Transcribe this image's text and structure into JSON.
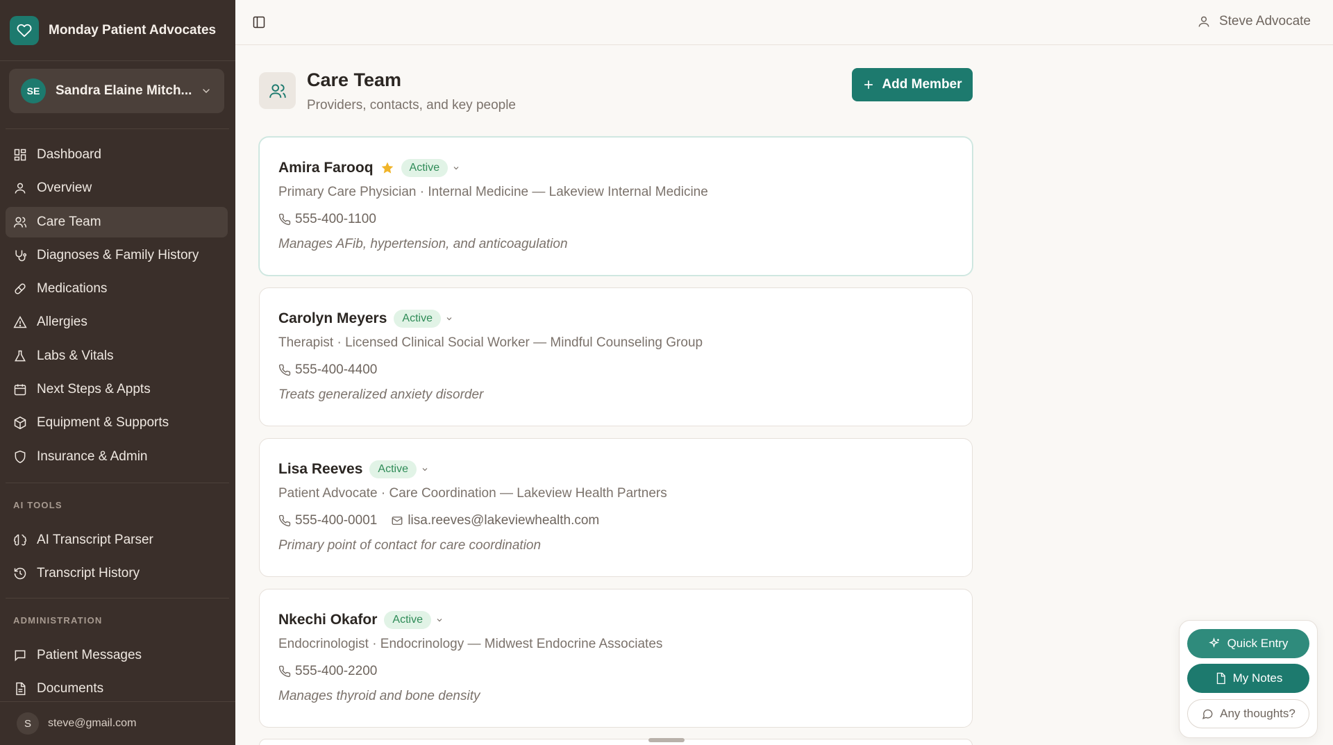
{
  "app": {
    "name": "Monday Patient Advocates"
  },
  "patient": {
    "initials": "SE",
    "name": "Sandra Elaine Mitch..."
  },
  "nav": {
    "main": [
      {
        "label": "Dashboard",
        "icon": "dashboard-icon"
      },
      {
        "label": "Overview",
        "icon": "user-icon"
      },
      {
        "label": "Care Team",
        "icon": "users-icon",
        "active": true
      },
      {
        "label": "Diagnoses & Family History",
        "icon": "stethoscope-icon"
      },
      {
        "label": "Medications",
        "icon": "pill-icon"
      },
      {
        "label": "Allergies",
        "icon": "warning-icon"
      },
      {
        "label": "Labs & Vitals",
        "icon": "flask-icon"
      },
      {
        "label": "Next Steps & Appts",
        "icon": "calendar-icon"
      },
      {
        "label": "Equipment & Supports",
        "icon": "box-icon"
      },
      {
        "label": "Insurance & Admin",
        "icon": "shield-icon"
      }
    ],
    "ai_tools_label": "AI TOOLS",
    "ai_tools": [
      {
        "label": "AI Transcript Parser",
        "icon": "brain-icon"
      },
      {
        "label": "Transcript History",
        "icon": "history-icon"
      }
    ],
    "admin_label": "ADMINISTRATION",
    "admin": [
      {
        "label": "Patient Messages",
        "icon": "message-icon"
      },
      {
        "label": "Documents",
        "icon": "document-icon"
      }
    ]
  },
  "footer": {
    "avatar": "S",
    "email": "steve@gmail.com"
  },
  "topbar": {
    "user_name": "Steve Advocate"
  },
  "page": {
    "title": "Care Team",
    "subtitle": "Providers, contacts, and key people",
    "add_button": "Add Member"
  },
  "members": [
    {
      "name": "Amira Farooq",
      "starred": true,
      "status": "Active",
      "role": "Primary Care Physician · Internal Medicine — Lakeview Internal Medicine",
      "phone": "555-400-1100",
      "email": "",
      "note": "Manages AFib, hypertension, and anticoagulation"
    },
    {
      "name": "Carolyn Meyers",
      "starred": false,
      "status": "Active",
      "role": "Therapist · Licensed Clinical Social Worker — Mindful Counseling Group",
      "phone": "555-400-4400",
      "email": "",
      "note": "Treats generalized anxiety disorder"
    },
    {
      "name": "Lisa Reeves",
      "starred": false,
      "status": "Active",
      "role": "Patient Advocate · Care Coordination — Lakeview Health Partners",
      "phone": "555-400-0001",
      "email": "lisa.reeves@lakeviewhealth.com",
      "note": "Primary point of contact for care coordination"
    },
    {
      "name": "Nkechi Okafor",
      "starred": false,
      "status": "Active",
      "role": "Endocrinologist · Endocrinology — Midwest Endocrine Associates",
      "phone": "555-400-2200",
      "email": "",
      "note": "Manages thyroid and bone density"
    }
  ],
  "floating": {
    "quick_entry": "Quick Entry",
    "my_notes": "My Notes",
    "thoughts": "Any thoughts?"
  },
  "colors": {
    "sidebar_bg": "#3a2f2a",
    "accent": "#1d7a6e",
    "active_badge_bg": "#e1f3e6",
    "active_badge_text": "#2e8b57",
    "star": "#f0b429"
  }
}
